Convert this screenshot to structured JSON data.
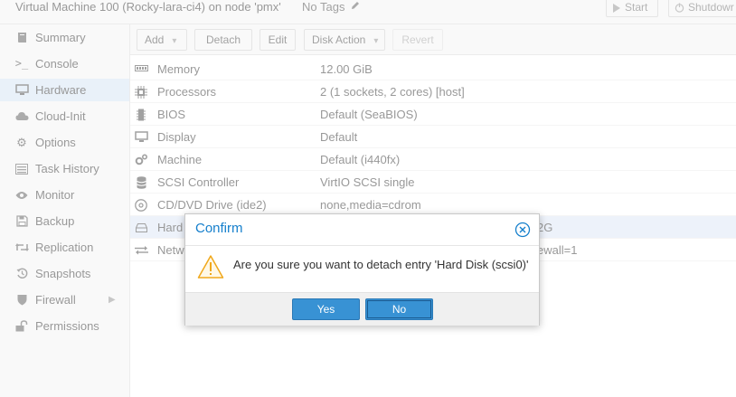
{
  "header": {
    "vm_title": "Virtual Machine 100 (Rocky-lara-ci4) on node 'pmx'",
    "tags_label": "No Tags",
    "start_label": "Start",
    "shutdown_label": "Shutdowr"
  },
  "sidebar": {
    "items": [
      {
        "label": "Summary",
        "icon": "book-icon"
      },
      {
        "label": "Console",
        "icon": "terminal-icon"
      },
      {
        "label": "Hardware",
        "icon": "desktop-icon",
        "active": true
      },
      {
        "label": "Cloud-Init",
        "icon": "cloud-icon"
      },
      {
        "label": "Options",
        "icon": "gear-icon"
      },
      {
        "label": "Task History",
        "icon": "list-icon"
      },
      {
        "label": "Monitor",
        "icon": "eye-icon"
      },
      {
        "label": "Backup",
        "icon": "floppy-icon"
      },
      {
        "label": "Replication",
        "icon": "retweet-icon"
      },
      {
        "label": "Snapshots",
        "icon": "history-icon"
      },
      {
        "label": "Firewall",
        "icon": "shield-icon"
      },
      {
        "label": "Permissions",
        "icon": "unlock-icon"
      }
    ]
  },
  "toolbar": {
    "add_label": "Add",
    "detach_label": "Detach",
    "edit_label": "Edit",
    "disk_action_label": "Disk Action",
    "revert_label": "Revert"
  },
  "hardware": {
    "rows": [
      {
        "name": "Memory",
        "value": "12.00 GiB",
        "icon": "memory-icon"
      },
      {
        "name": "Processors",
        "value": "2 (1 sockets, 2 cores) [host]",
        "icon": "cpu-icon"
      },
      {
        "name": "BIOS",
        "value": "Default (SeaBIOS)",
        "icon": "microchip-icon"
      },
      {
        "name": "Display",
        "value": "Default",
        "icon": "desktop-icon"
      },
      {
        "name": "Machine",
        "value": "Default (i440fx)",
        "icon": "cogs-icon"
      },
      {
        "name": "SCSI Controller",
        "value": "VirtIO SCSI single",
        "icon": "database-icon"
      },
      {
        "name": "CD/DVD Drive (ide2)",
        "value": "none,media=cdrom",
        "icon": "cdrom-icon"
      },
      {
        "name": "Hard",
        "value": "2G",
        "icon": "hdd-icon",
        "selected": true
      },
      {
        "name": "Netw",
        "value": "ewall=1",
        "icon": "exchange-icon"
      }
    ]
  },
  "dialog": {
    "title": "Confirm",
    "message": "Are you sure you want to detach entry 'Hard Disk (scsi0)'",
    "yes_label": "Yes",
    "no_label": "No"
  },
  "colors": {
    "accent": "#157fcc",
    "button_blue": "#3892d4",
    "warning": "#f0a81c",
    "selected_row": "#dfe8f6"
  }
}
